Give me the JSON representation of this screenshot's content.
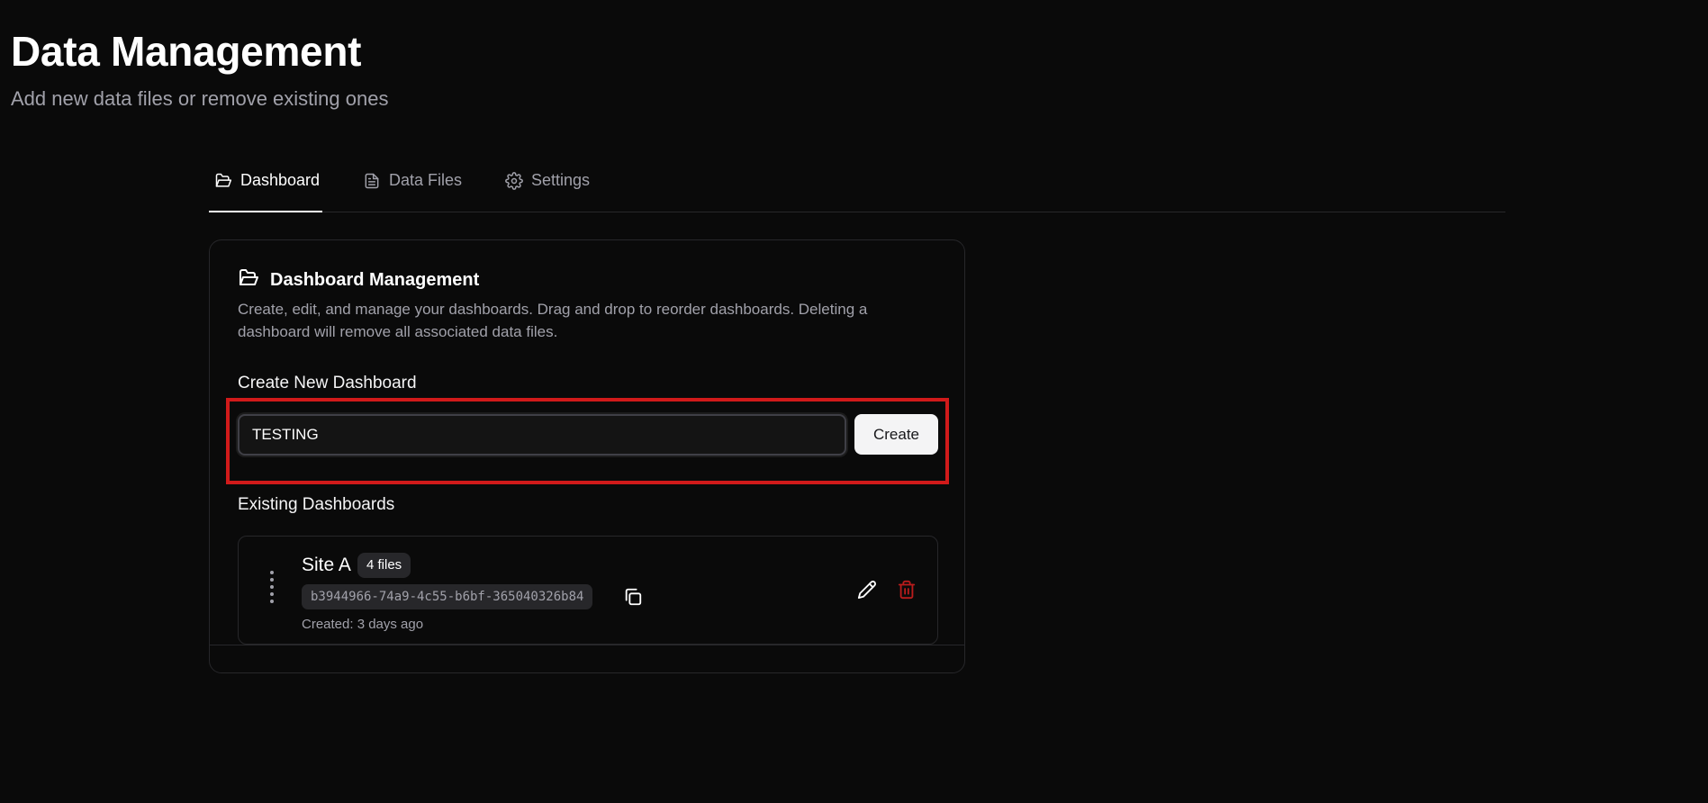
{
  "header": {
    "title": "Data Management",
    "subtitle": "Add new data files or remove existing ones"
  },
  "tabs": [
    {
      "label": "Dashboard",
      "icon": "folder-open-icon",
      "active": true
    },
    {
      "label": "Data Files",
      "icon": "file-text-icon",
      "active": false
    },
    {
      "label": "Settings",
      "icon": "gear-icon",
      "active": false
    }
  ],
  "card": {
    "title": "Dashboard Management",
    "icon": "folder-open-icon",
    "description": "Create, edit, and manage your dashboards. Drag and drop to reorder dashboards. Deleting a dashboard will remove all associated data files."
  },
  "create": {
    "label": "Create New Dashboard",
    "input_value": "TESTING",
    "button_label": "Create"
  },
  "existing": {
    "label": "Existing Dashboards",
    "items": [
      {
        "name": "Site A",
        "files_badge": "4 files",
        "id": "b3944966-74a9-4c55-b6bf-365040326b84",
        "created": "Created: 3 days ago"
      }
    ]
  },
  "colors": {
    "background": "#0a0a0a",
    "highlight": "#d11a1a",
    "delete": "#b91c1c"
  }
}
